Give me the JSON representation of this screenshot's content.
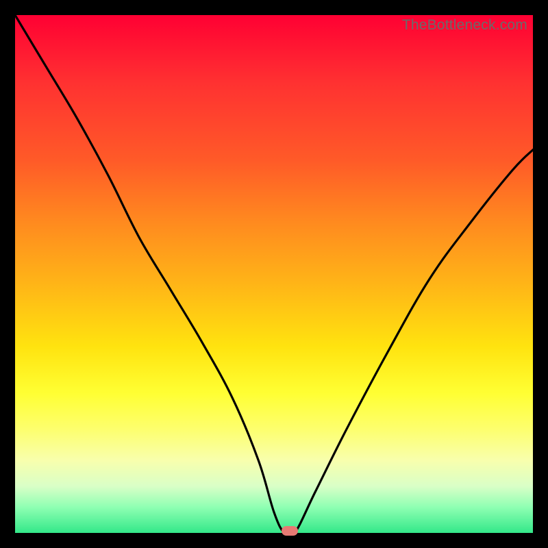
{
  "watermark": "TheBottleneck.com",
  "colors": {
    "frame": "#000000",
    "curve": "#000000",
    "marker": "#e77a73",
    "gradient_top": "#ff0033",
    "gradient_bottom": "#33e889"
  },
  "chart_data": {
    "type": "line",
    "title": "",
    "xlabel": "",
    "ylabel": "",
    "xlim": [
      0,
      100
    ],
    "ylim": [
      0,
      100
    ],
    "grid": false,
    "legend": false,
    "annotations": [
      {
        "name": "marker",
        "x": 53,
        "y": 0
      }
    ],
    "series": [
      {
        "name": "bottleneck-curve",
        "x": [
          0,
          6,
          12,
          18,
          24,
          30,
          36,
          42,
          47,
          50,
          52,
          54,
          58,
          64,
          72,
          80,
          88,
          96,
          100
        ],
        "y": [
          100,
          90,
          80,
          69,
          57,
          47,
          37,
          26,
          14,
          4,
          0,
          0,
          8,
          20,
          35,
          49,
          60,
          70,
          74
        ]
      }
    ]
  }
}
